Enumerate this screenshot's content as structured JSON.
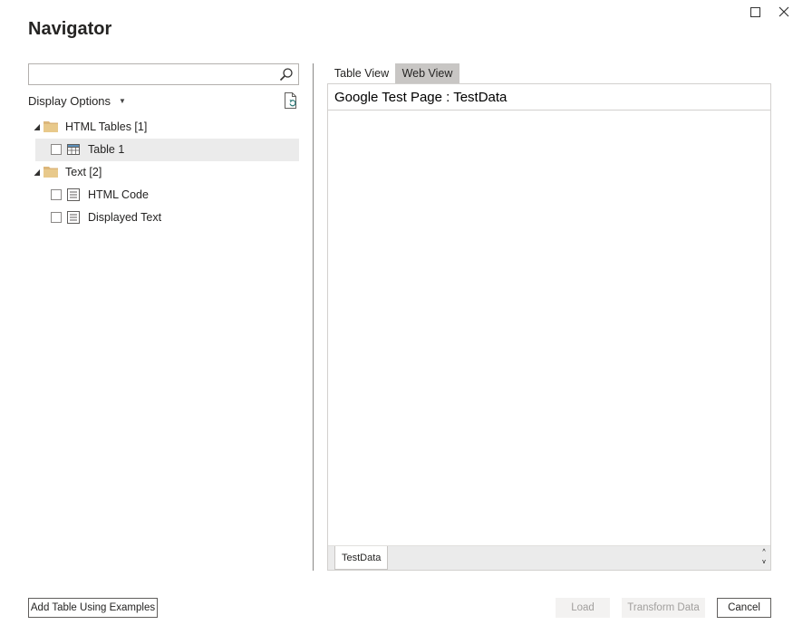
{
  "window": {
    "title": "Navigator",
    "maximize_icon": "maximize-icon",
    "close_icon": "close-icon"
  },
  "search": {
    "value": "",
    "placeholder": "",
    "icon": "search-icon"
  },
  "display_options": {
    "label": "Display Options",
    "caret": "▼"
  },
  "refresh_icon": "refresh-icon",
  "tree": {
    "groups": [
      {
        "label": "HTML Tables [1]",
        "expanded": true,
        "items": [
          {
            "label": "Table 1",
            "icon": "table-icon",
            "checked": false,
            "selected": true
          }
        ]
      },
      {
        "label": "Text [2]",
        "expanded": true,
        "items": [
          {
            "label": "HTML Code",
            "icon": "document-icon",
            "checked": false,
            "selected": false
          },
          {
            "label": "Displayed Text",
            "icon": "document-icon",
            "checked": false,
            "selected": false
          }
        ]
      }
    ]
  },
  "tabs": [
    {
      "label": "Table View",
      "active": false
    },
    {
      "label": "Web View",
      "active": true
    }
  ],
  "preview": {
    "heading": "Google Test Page : TestData",
    "sheet_tab": "TestData",
    "scroll_up": "^",
    "scroll_down": "v"
  },
  "footer": {
    "add_table_label": "Add Table Using Examples",
    "load_label": "Load",
    "transform_label": "Transform Data",
    "cancel_label": "Cancel"
  },
  "colors": {
    "accent_folder": "#dcb67a",
    "active_tab_bg": "#c8c6c4",
    "selected_row_bg": "#ebebeb",
    "disabled_text": "#a19f9d"
  }
}
